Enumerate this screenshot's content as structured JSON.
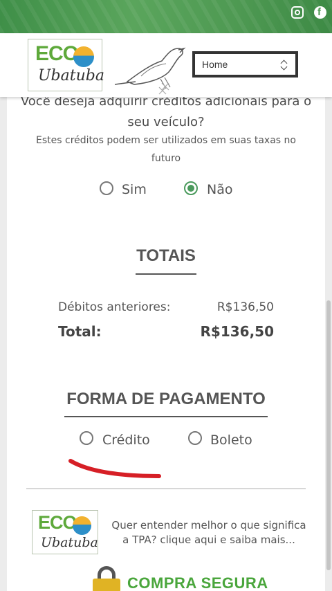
{
  "header": {
    "social": [
      {
        "icon": "instagram-icon"
      },
      {
        "icon": "facebook-icon"
      }
    ],
    "facebook_glyph": "f",
    "logo": {
      "eco": "ECO",
      "city": "Ubatuba"
    },
    "nav_select": {
      "value": "Home"
    }
  },
  "credits_question": {
    "line1": "Você deseja adquirir créditos adicionais para o",
    "line2": "seu veículo?",
    "sub1": "Estes créditos podem ser utilizados em suas taxas no",
    "sub2": "futuro",
    "options": [
      {
        "label": "Sim",
        "selected": false
      },
      {
        "label": "Não",
        "selected": true
      }
    ]
  },
  "totals": {
    "heading": "TOTAIS",
    "debits_label": "Débitos anteriores:",
    "debits_value": "R$136,50",
    "total_label": "Total:",
    "total_value": "R$136,50"
  },
  "payment": {
    "heading": "FORMA DE PAGAMENTO",
    "options": [
      {
        "label": "Crédito",
        "selected": false
      },
      {
        "label": "Boleto",
        "selected": false
      }
    ]
  },
  "footer": {
    "logo": {
      "eco": "ECO",
      "city": "Ubatuba"
    },
    "tpa_line1": "Quer entender melhor o que significa",
    "tpa_line2": "a TPA? clique aqui e saiba mais...",
    "secure_label": "COMPRA SEGURA"
  },
  "colors": {
    "brand_green": "#5ea93b",
    "radio_green": "#4a9a5c",
    "annotation_red": "#d61f26"
  }
}
